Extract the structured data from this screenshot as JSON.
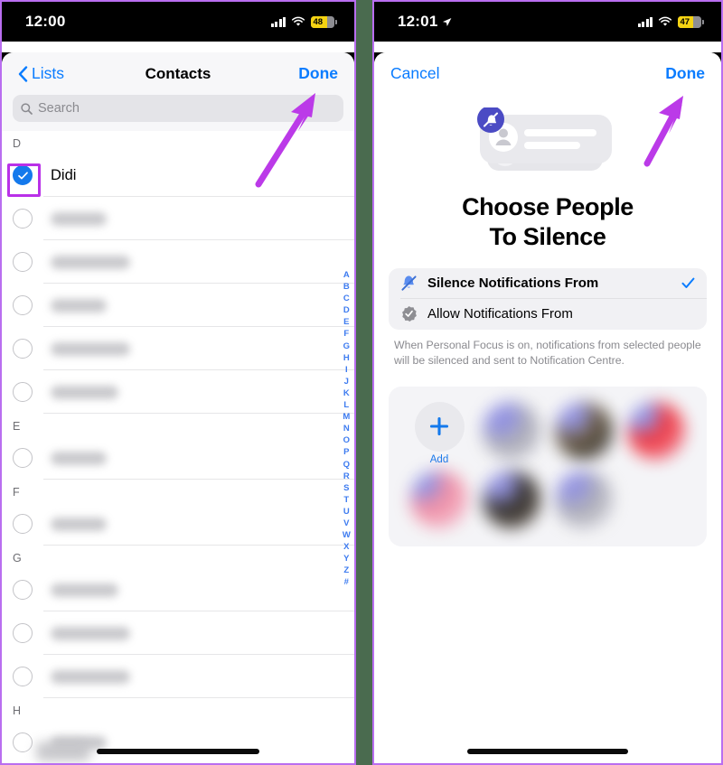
{
  "meta": {
    "accent_blue": "#0a7cff",
    "accent_purple": "#b930e8",
    "battery_yellow": "#f5d312",
    "background_green": "#4a6b4f"
  },
  "left_phone": {
    "status_bar": {
      "time": "12:00",
      "cellular_icon": "signal-bars-icon",
      "wifi_icon": "wifi-icon",
      "battery_level": "48",
      "battery_icon": "battery-low-power-icon"
    },
    "navbar": {
      "back_label": "Lists",
      "back_icon": "chevron-left-icon",
      "title": "Contacts",
      "done_label": "Done"
    },
    "search": {
      "placeholder": "Search",
      "icon": "search-icon"
    },
    "sections": [
      {
        "letter": "D",
        "rows": [
          {
            "name": "Didi",
            "checked": true,
            "redacted": false,
            "highlighted": true
          },
          {
            "name": "",
            "checked": false,
            "redacted": true,
            "blob": "w1"
          },
          {
            "name": "",
            "checked": false,
            "redacted": true,
            "blob": "w2"
          },
          {
            "name": "",
            "checked": false,
            "redacted": true,
            "blob": "w1"
          },
          {
            "name": "",
            "checked": false,
            "redacted": true,
            "blob": "w2"
          },
          {
            "name": "",
            "checked": false,
            "redacted": true,
            "blob": "w3"
          }
        ]
      },
      {
        "letter": "E",
        "rows": [
          {
            "name": "",
            "checked": false,
            "redacted": true,
            "blob": "w1"
          }
        ]
      },
      {
        "letter": "F",
        "rows": [
          {
            "name": "",
            "checked": false,
            "redacted": true,
            "blob": "w1"
          }
        ]
      },
      {
        "letter": "G",
        "rows": [
          {
            "name": "",
            "checked": false,
            "redacted": true,
            "blob": "w3"
          },
          {
            "name": "",
            "checked": false,
            "redacted": true,
            "blob": "w2"
          },
          {
            "name": "",
            "checked": false,
            "redacted": true,
            "blob": "w2"
          }
        ]
      },
      {
        "letter": "H",
        "rows": [
          {
            "name": "",
            "checked": false,
            "redacted": true,
            "blob": "w1"
          }
        ]
      }
    ],
    "alpha_index": [
      "A",
      "B",
      "C",
      "D",
      "E",
      "F",
      "G",
      "H",
      "I",
      "J",
      "K",
      "L",
      "M",
      "N",
      "O",
      "P",
      "Q",
      "R",
      "S",
      "T",
      "U",
      "V",
      "W",
      "X",
      "Y",
      "Z",
      "#"
    ]
  },
  "right_phone": {
    "status_bar": {
      "time": "12:01",
      "location_icon": "location-arrow-icon",
      "cellular_icon": "signal-bars-icon",
      "wifi_icon": "wifi-icon",
      "battery_level": "47",
      "battery_icon": "battery-low-power-icon"
    },
    "navbar": {
      "cancel_label": "Cancel",
      "done_label": "Done"
    },
    "illustration_icon": "silenced-notification-card-icon",
    "hero_title_line1": "Choose People",
    "hero_title_line2": "To Silence",
    "options": [
      {
        "label": "Silence Notifications From",
        "icon": "bell-slash-icon",
        "selected": true,
        "check_icon": "checkmark-icon"
      },
      {
        "label": "Allow Notifications From",
        "icon": "checkmark-seal-icon",
        "selected": false
      }
    ],
    "footnote": "When Personal Focus is on, notifications from selected people will be silenced and sent to Notification Centre.",
    "people": {
      "add_label": "Add",
      "add_icon": "plus-icon",
      "avatars": [
        "av1",
        "av2",
        "av3",
        "av4",
        "av5",
        "av6"
      ]
    }
  },
  "annotations": {
    "arrow_left": "purple-arrow-pointing-to-done",
    "arrow_right": "purple-arrow-pointing-to-done"
  }
}
